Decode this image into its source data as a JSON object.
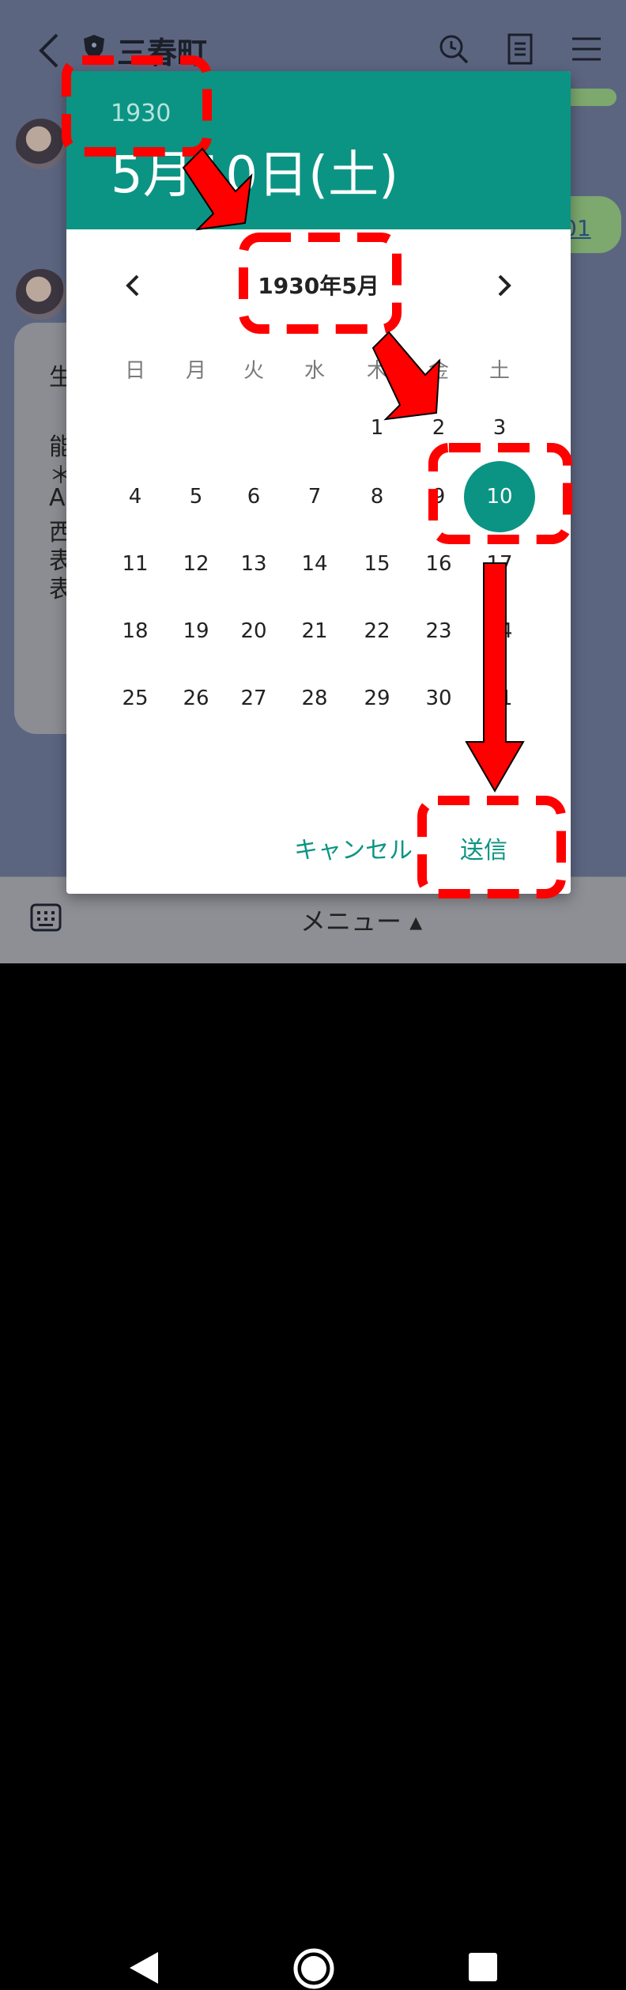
{
  "chat": {
    "title": "三春町",
    "link_snippet": "01",
    "message_lines": [
      "生",
      "能",
      "＊",
      "A",
      "西",
      "表",
      "表"
    ]
  },
  "bottom_bar": {
    "menu_label": "メニュー ▴"
  },
  "date_picker": {
    "header_year": "1930",
    "header_date": "5月10日(土)",
    "month_title": "1930年5月",
    "weekdays": [
      "日",
      "月",
      "火",
      "水",
      "木",
      "金",
      "土"
    ],
    "days": [
      "1",
      "2",
      "3",
      "4",
      "5",
      "6",
      "7",
      "8",
      "9",
      "10",
      "11",
      "12",
      "13",
      "14",
      "15",
      "16",
      "17",
      "18",
      "19",
      "20",
      "21",
      "22",
      "23",
      "24",
      "25",
      "26",
      "27",
      "28",
      "29",
      "30",
      "31"
    ],
    "selected_day": "10",
    "cancel_label": "キャンセル",
    "send_label": "送信"
  },
  "colors": {
    "accent": "#0b9483",
    "annotation": "#ff0000"
  },
  "icons": [
    "back-icon",
    "shield-icon",
    "clock-search-icon",
    "note-icon",
    "menu-icon",
    "keyboard-icon",
    "nav-back-icon",
    "nav-home-icon",
    "nav-recent-icon",
    "chevron-left-icon",
    "chevron-right-icon"
  ]
}
